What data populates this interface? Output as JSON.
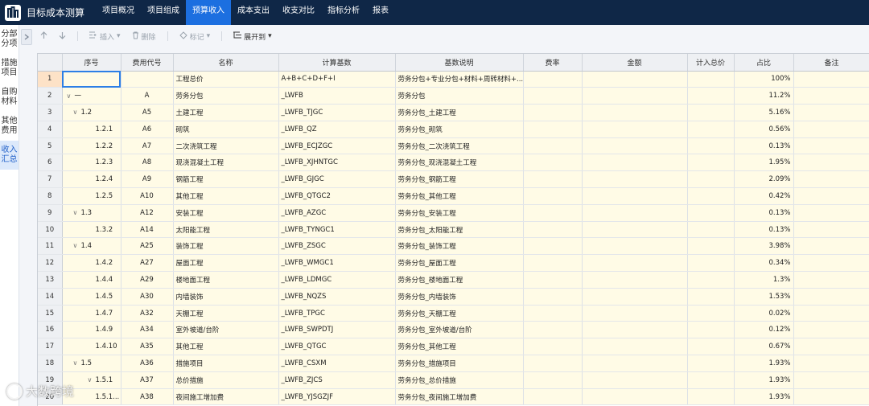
{
  "app": {
    "title": "目标成本测算",
    "logo_icon": "building-logo-icon"
  },
  "nav": {
    "tabs": [
      "项目概况",
      "项目组成",
      "预算收入",
      "成本支出",
      "收支对比",
      "指标分析",
      "报表"
    ],
    "active_index": 2
  },
  "sidebar": {
    "items": [
      {
        "label": "分部分项"
      },
      {
        "label": "措施项目"
      },
      {
        "label": "自购材料"
      },
      {
        "label": "其他费用"
      },
      {
        "label": "收入汇总"
      }
    ],
    "active_index": 4,
    "collapse_icon": "chevron-right-icon"
  },
  "toolbar": {
    "up_icon": "arrow-up-icon",
    "down_icon": "arrow-down-icon",
    "insert_label": "插入",
    "delete_label": "删除",
    "mark_label": "标记",
    "expand_label": "展开到"
  },
  "table": {
    "headers": [
      "序号",
      "费用代号",
      "名称",
      "计算基数",
      "基数说明",
      "费率",
      "金额",
      "计入总价",
      "占比",
      "备注"
    ],
    "rows": [
      {
        "n": "1",
        "seq": "",
        "level": 0,
        "chev": "",
        "code": "",
        "name": "工程总价",
        "base": "A+B+C+D+F+I",
        "desc": "劳务分包+专业分包+材料+周转材料+...",
        "pct": "100%"
      },
      {
        "n": "2",
        "seq": "一",
        "level": 0,
        "chev": "v",
        "code": "A",
        "name": "劳务分包",
        "base": "_LWFB",
        "desc": "劳务分包",
        "pct": "11.2%"
      },
      {
        "n": "3",
        "seq": "1.2",
        "level": 1,
        "chev": "v",
        "code": "A5",
        "name": "土建工程",
        "base": "_LWFB_TJGC",
        "desc": "劳务分包_土建工程",
        "pct": "5.16%"
      },
      {
        "n": "4",
        "seq": "1.2.1",
        "level": 2,
        "chev": "",
        "code": "A6",
        "name": "砌筑",
        "base": "_LWFB_QZ",
        "desc": "劳务分包_砌筑",
        "pct": "0.56%"
      },
      {
        "n": "5",
        "seq": "1.2.2",
        "level": 2,
        "chev": "",
        "code": "A7",
        "name": "二次浇筑工程",
        "base": "_LWFB_ECJZGC",
        "desc": "劳务分包_二次浇筑工程",
        "pct": "0.13%"
      },
      {
        "n": "6",
        "seq": "1.2.3",
        "level": 2,
        "chev": "",
        "code": "A8",
        "name": "现浇混凝土工程",
        "base": "_LWFB_XJHNTGC",
        "desc": "劳务分包_现浇混凝土工程",
        "pct": "1.95%"
      },
      {
        "n": "7",
        "seq": "1.2.4",
        "level": 2,
        "chev": "",
        "code": "A9",
        "name": "钢筋工程",
        "base": "_LWFB_GJGC",
        "desc": "劳务分包_钢筋工程",
        "pct": "2.09%"
      },
      {
        "n": "8",
        "seq": "1.2.5",
        "level": 2,
        "chev": "",
        "code": "A10",
        "name": "其他工程",
        "base": "_LWFB_QTGC2",
        "desc": "劳务分包_其他工程",
        "pct": "0.42%"
      },
      {
        "n": "9",
        "seq": "1.3",
        "level": 1,
        "chev": "v",
        "code": "A12",
        "name": "安装工程",
        "base": "_LWFB_AZGC",
        "desc": "劳务分包_安装工程",
        "pct": "0.13%"
      },
      {
        "n": "10",
        "seq": "1.3.2",
        "level": 2,
        "chev": "",
        "code": "A14",
        "name": "太阳能工程",
        "base": "_LWFB_TYNGC1",
        "desc": "劳务分包_太阳能工程",
        "pct": "0.13%"
      },
      {
        "n": "11",
        "seq": "1.4",
        "level": 1,
        "chev": "v",
        "code": "A25",
        "name": "装饰工程",
        "base": "_LWFB_ZSGC",
        "desc": "劳务分包_装饰工程",
        "pct": "3.98%"
      },
      {
        "n": "12",
        "seq": "1.4.2",
        "level": 2,
        "chev": "",
        "code": "A27",
        "name": "屋面工程",
        "base": "_LWFB_WMGC1",
        "desc": "劳务分包_屋面工程",
        "pct": "0.34%"
      },
      {
        "n": "13",
        "seq": "1.4.4",
        "level": 2,
        "chev": "",
        "code": "A29",
        "name": "楼地面工程",
        "base": "_LWFB_LDMGC",
        "desc": "劳务分包_楼地面工程",
        "pct": "1.3%"
      },
      {
        "n": "14",
        "seq": "1.4.5",
        "level": 2,
        "chev": "",
        "code": "A30",
        "name": "内墙装饰",
        "base": "_LWFB_NQZS",
        "desc": "劳务分包_内墙装饰",
        "pct": "1.53%"
      },
      {
        "n": "15",
        "seq": "1.4.7",
        "level": 2,
        "chev": "",
        "code": "A32",
        "name": "天棚工程",
        "base": "_LWFB_TPGC",
        "desc": "劳务分包_天棚工程",
        "pct": "0.02%"
      },
      {
        "n": "16",
        "seq": "1.4.9",
        "level": 2,
        "chev": "",
        "code": "A34",
        "name": "室外坡道/台阶",
        "base": "_LWFB_SWPDTJ",
        "desc": "劳务分包_室外坡道/台阶",
        "pct": "0.12%"
      },
      {
        "n": "17",
        "seq": "1.4.10",
        "level": 2,
        "chev": "",
        "code": "A35",
        "name": "其他工程",
        "base": "_LWFB_QTGC",
        "desc": "劳务分包_其他工程",
        "pct": "0.67%"
      },
      {
        "n": "18",
        "seq": "1.5",
        "level": 1,
        "chev": "v",
        "code": "A36",
        "name": "措施项目",
        "base": "_LWFB_CSXM",
        "desc": "劳务分包_措施项目",
        "pct": "1.93%"
      },
      {
        "n": "19",
        "seq": "1.5.1",
        "level": 2,
        "chev": "v",
        "code": "A37",
        "name": "总价措施",
        "base": "_LWFB_ZJCS",
        "desc": "劳务分包_总价措施",
        "pct": "1.93%"
      },
      {
        "n": "20",
        "seq": "1.5.1...",
        "level": 2,
        "chev": "",
        "code": "A38",
        "name": "夜间施工增加费",
        "base": "_LWFB_YJSGZJF",
        "desc": "劳务分包_夜间施工增加费",
        "pct": "1.93%"
      }
    ]
  },
  "watermark": {
    "label": "大数跨境",
    "icon": "bubble-logo-icon"
  }
}
